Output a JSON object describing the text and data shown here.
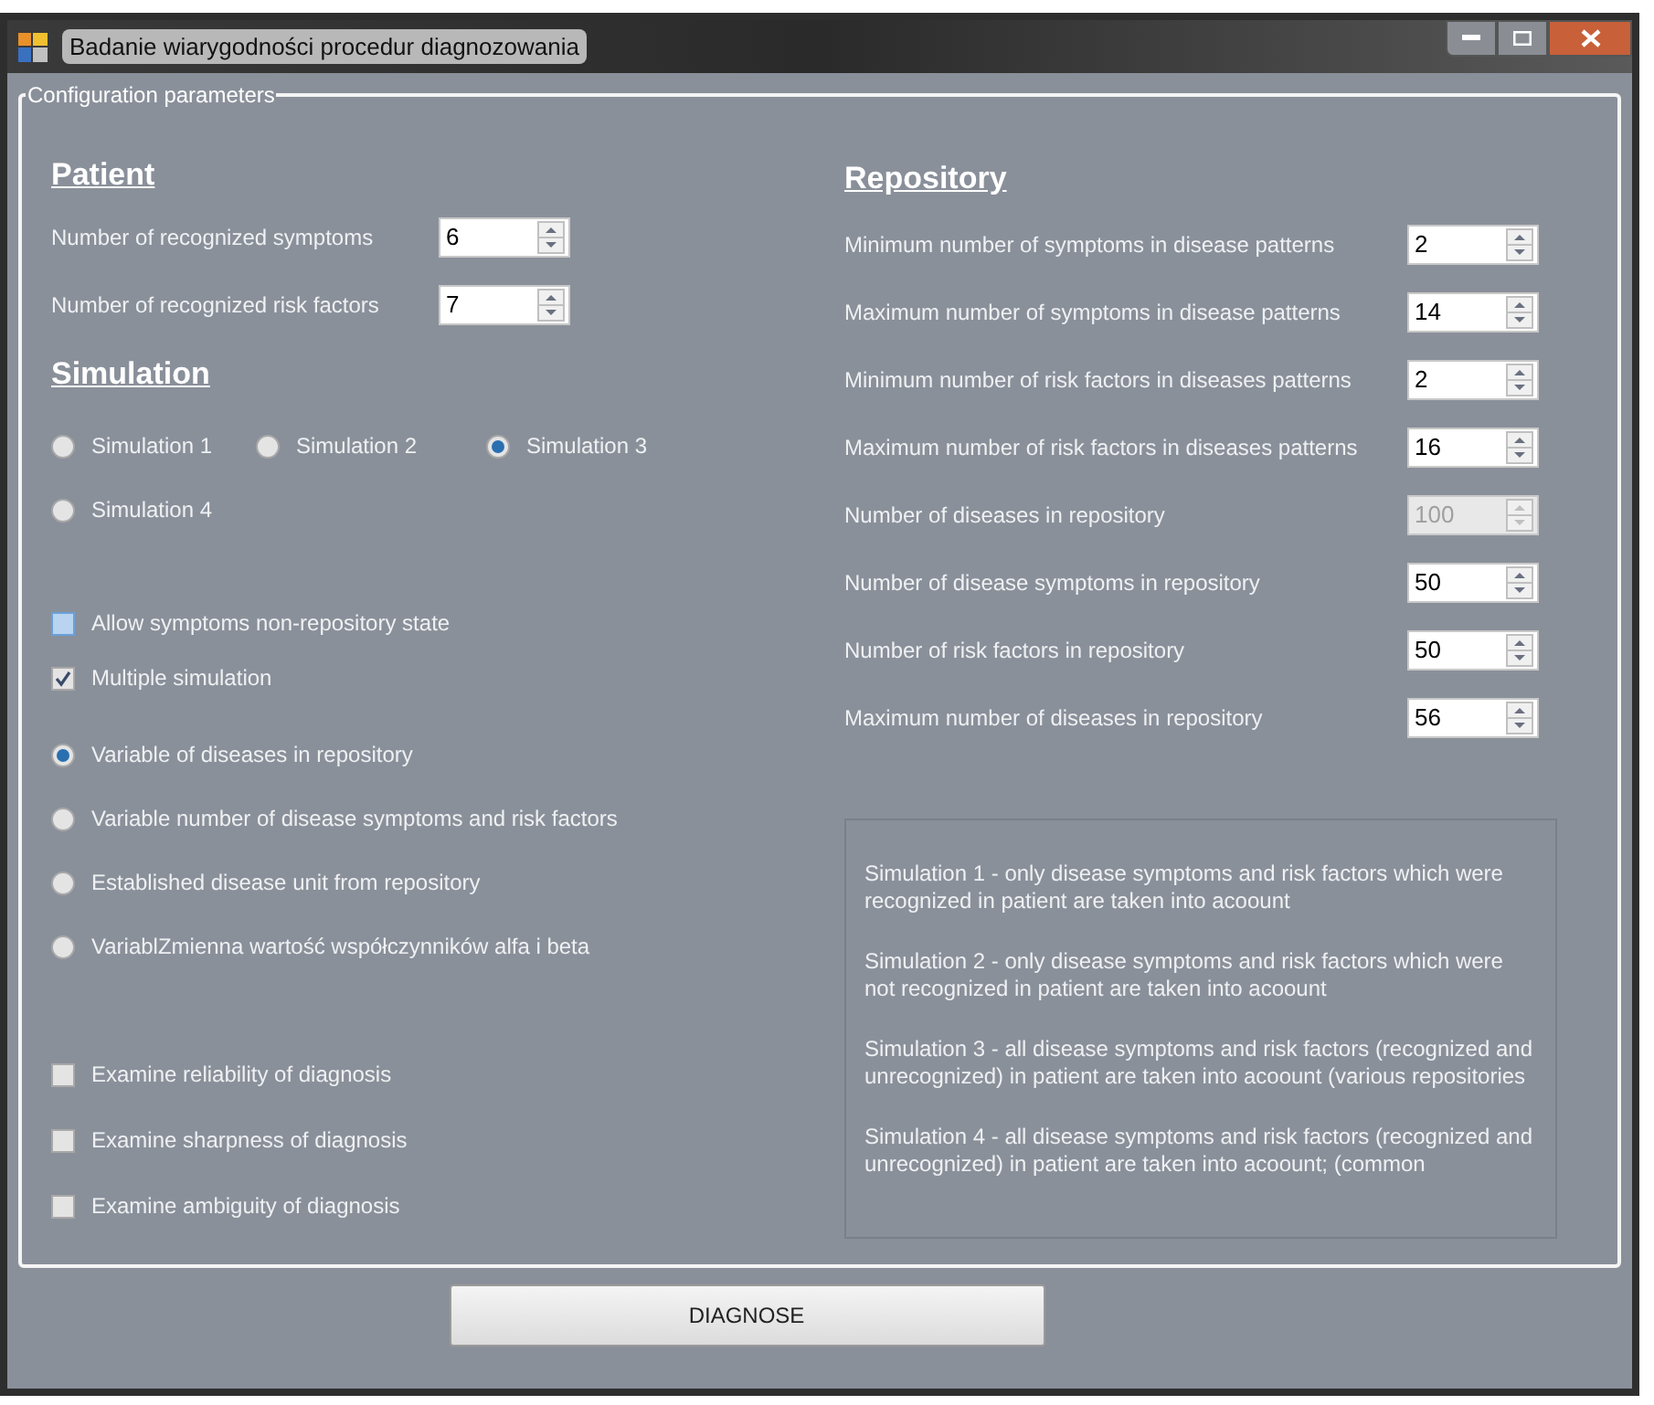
{
  "window": {
    "title": "Badanie wiarygodności procedur diagnozowania"
  },
  "group": {
    "title": "Configuration parameters"
  },
  "patient": {
    "heading": "Patient",
    "fields": [
      {
        "label": "Number of recognized symptoms",
        "value": "6",
        "disabled": false
      },
      {
        "label": "Number of recognized risk factors",
        "value": "7",
        "disabled": false
      }
    ]
  },
  "simulation": {
    "heading": "Simulation",
    "options": [
      {
        "label": "Simulation 1",
        "selected": false
      },
      {
        "label": "Simulation 2",
        "selected": false
      },
      {
        "label": "Simulation 3",
        "selected": true
      },
      {
        "label": "Simulation 4",
        "selected": false
      }
    ]
  },
  "options": [
    {
      "label": "Allow symptoms non-repository state",
      "checked": false,
      "hovered": true
    },
    {
      "label": "Multiple simulation",
      "checked": true,
      "hovered": false
    }
  ],
  "variation": [
    {
      "label": "Variable of diseases in repository",
      "selected": true
    },
    {
      "label": "Variable number of disease symptoms and risk factors",
      "selected": false
    },
    {
      "label": "Established disease unit from repository",
      "selected": false
    },
    {
      "label": "VariablZmienna wartość współczynników alfa i beta",
      "selected": false
    }
  ],
  "examine": [
    {
      "label": "Examine reliability of diagnosis",
      "checked": false
    },
    {
      "label": "Examine sharpness of diagnosis",
      "checked": false
    },
    {
      "label": "Examine ambiguity of diagnosis",
      "checked": false
    }
  ],
  "repository": {
    "heading": "Repository",
    "fields": [
      {
        "label": "Minimum number of symptoms in disease patterns",
        "value": "2",
        "disabled": false
      },
      {
        "label": "Maximum number of symptoms in disease patterns",
        "value": "14",
        "disabled": false
      },
      {
        "label": "Minimum number of risk factors in diseases patterns",
        "value": "2",
        "disabled": false
      },
      {
        "label": "Maximum number of risk factors in diseases patterns",
        "value": "16",
        "disabled": false
      },
      {
        "label": "Number of diseases in repository",
        "value": "100",
        "disabled": true
      },
      {
        "label": "Number of disease symptoms in repository",
        "value": "50",
        "disabled": false
      },
      {
        "label": "Number of risk factors in repository",
        "value": "50",
        "disabled": false
      },
      {
        "label": "Maximum number of diseases in repository",
        "value": "56",
        "disabled": false
      }
    ]
  },
  "info": [
    "Simulation 1 - only disease symptoms and risk factors which were recognized in patient are taken into acoount",
    "Simulation 2 - only disease symptoms and risk factors which were not recognized in patient are taken into acoount",
    "Simulation 3 - all disease symptoms and risk factors (recognized and unrecognized) in patient are taken into acoount (various repositories",
    "Simulation 4 - all disease symptoms and risk factors (recognized and unrecognized) in patient are taken into acoount; (common"
  ],
  "button": "DIAGNOSE"
}
